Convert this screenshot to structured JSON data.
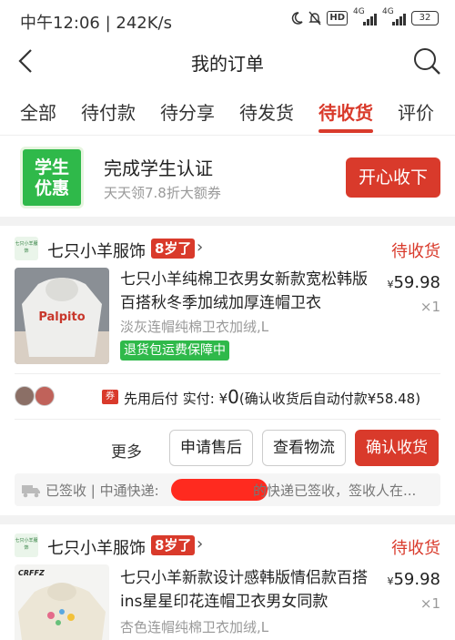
{
  "status_bar": {
    "time": "中午12:06 | 242K/s",
    "hd_label": "HD",
    "net1": "4G",
    "net2": "4G",
    "battery": "32"
  },
  "header": {
    "title": "我的订单"
  },
  "tabs": [
    {
      "label": "全部",
      "active": false
    },
    {
      "label": "待付款",
      "active": false
    },
    {
      "label": "待分享",
      "active": false
    },
    {
      "label": "待发货",
      "active": false
    },
    {
      "label": "待收货",
      "active": true
    },
    {
      "label": "评价",
      "active": false
    }
  ],
  "promo": {
    "badge_line1": "学生",
    "badge_line2": "优惠",
    "title": "完成学生认证",
    "subtitle": "天天领7.8折大额券",
    "button": "开心收下"
  },
  "orders": [
    {
      "shop_logo_text": "七只小羊服饰",
      "shop_name": "七只小羊服饰",
      "shop_age": "8岁了",
      "status": "待收货",
      "thumb_text": "Palpito",
      "title": "七只小羊纯棉卫衣男女新款宽松韩版百搭秋冬季加绒加厚连帽卫衣",
      "variant": "淡灰连帽纯棉卫衣加绒,L",
      "guarantee": "退货包运费保障中",
      "price_symbol": "¥",
      "price": "59.98",
      "qty": "×1",
      "ticket": "券",
      "pay_label": "先用后付 实付: ¥",
      "pay_amount": "0",
      "pay_note": "(确认收货后自动付款¥58.48)",
      "more": "更多",
      "btn_after_sale": "申请售后",
      "btn_logistics": "查看物流",
      "btn_confirm": "确认收货",
      "logistics_prefix": "已签收 | 中通快递:",
      "logistics_suffix": "的快递已签收，签收人在..."
    },
    {
      "shop_logo_text": "七只小羊服饰",
      "shop_name": "七只小羊服饰",
      "shop_age": "8岁了",
      "status": "待收货",
      "thumb_text": "CRFFZ",
      "title": "七只小羊新款设计感韩版情侣款百搭ins星星印花连帽卫衣男女同款",
      "variant": "杏色连帽纯棉卫衣加绒,L",
      "price_symbol": "¥",
      "price": "59.98",
      "qty": "×1"
    }
  ]
}
